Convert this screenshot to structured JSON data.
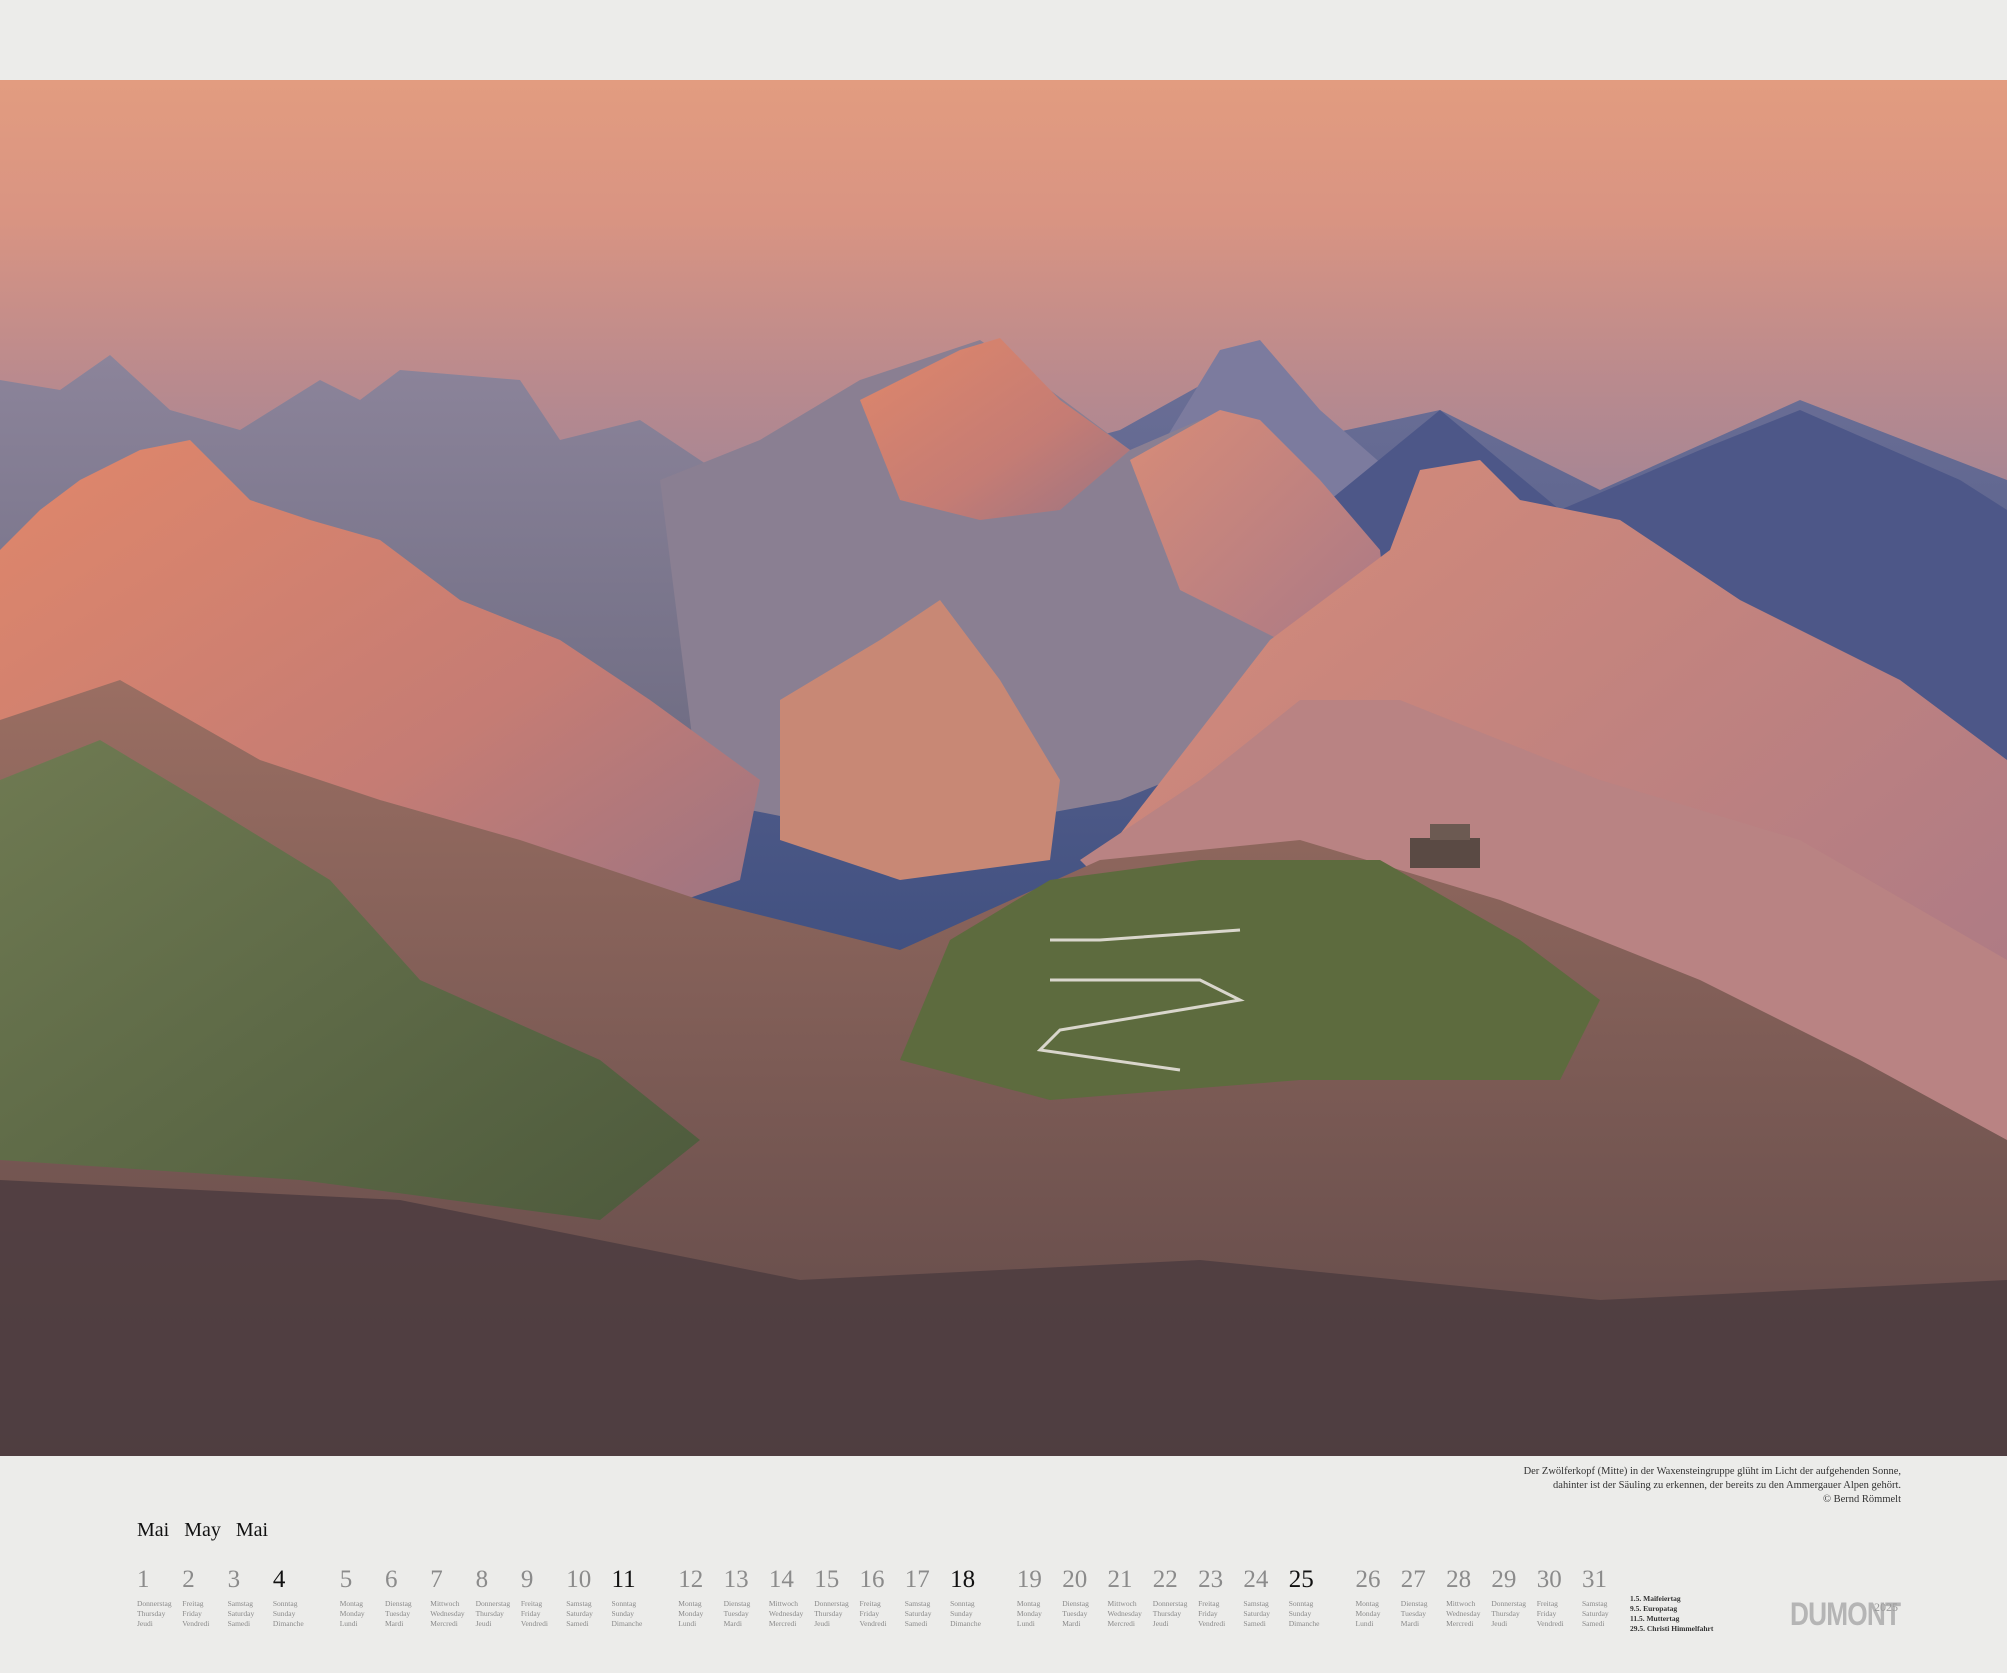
{
  "photo": {
    "name": "Zwölferkopf und Säuling bei Sonnenaufgang"
  },
  "caption": {
    "line1": "Der Zwölferkopf (Mitte) in der Waxensteingruppe glüht im Licht der aufgehenden Sonne,",
    "line2": "dahinter ist der Säuling zu erkennen, der bereits zu den Ammergauer Alpen gehört.",
    "credit": "© Bernd Römmelt"
  },
  "month": {
    "de": "Mai",
    "en": "May",
    "fr": "Mai"
  },
  "days": [
    {
      "n": "1",
      "de": "Donnerstag",
      "en": "Thursday",
      "fr": "Jeudi"
    },
    {
      "n": "2",
      "de": "Freitag",
      "en": "Friday",
      "fr": "Vendredi"
    },
    {
      "n": "3",
      "de": "Samstag",
      "en": "Saturday",
      "fr": "Samedi"
    },
    {
      "n": "4",
      "de": "Sonntag",
      "en": "Sunday",
      "fr": "Dimanche"
    },
    {
      "n": "5",
      "de": "Montag",
      "en": "Monday",
      "fr": "Lundi"
    },
    {
      "n": "6",
      "de": "Dienstag",
      "en": "Tuesday",
      "fr": "Mardi"
    },
    {
      "n": "7",
      "de": "Mittwoch",
      "en": "Wednesday",
      "fr": "Mercredi"
    },
    {
      "n": "8",
      "de": "Donnerstag",
      "en": "Thursday",
      "fr": "Jeudi"
    },
    {
      "n": "9",
      "de": "Freitag",
      "en": "Friday",
      "fr": "Vendredi"
    },
    {
      "n": "10",
      "de": "Samstag",
      "en": "Saturday",
      "fr": "Samedi"
    },
    {
      "n": "11",
      "de": "Sonntag",
      "en": "Sunday",
      "fr": "Dimanche"
    },
    {
      "n": "12",
      "de": "Montag",
      "en": "Monday",
      "fr": "Lundi"
    },
    {
      "n": "13",
      "de": "Dienstag",
      "en": "Tuesday",
      "fr": "Mardi"
    },
    {
      "n": "14",
      "de": "Mittwoch",
      "en": "Wednesday",
      "fr": "Mercredi"
    },
    {
      "n": "15",
      "de": "Donnerstag",
      "en": "Thursday",
      "fr": "Jeudi"
    },
    {
      "n": "16",
      "de": "Freitag",
      "en": "Friday",
      "fr": "Vendredi"
    },
    {
      "n": "17",
      "de": "Samstag",
      "en": "Saturday",
      "fr": "Samedi"
    },
    {
      "n": "18",
      "de": "Sonntag",
      "en": "Sunday",
      "fr": "Dimanche"
    },
    {
      "n": "19",
      "de": "Montag",
      "en": "Monday",
      "fr": "Lundi"
    },
    {
      "n": "20",
      "de": "Dienstag",
      "en": "Tuesday",
      "fr": "Mardi"
    },
    {
      "n": "21",
      "de": "Mittwoch",
      "en": "Wednesday",
      "fr": "Mercredi"
    },
    {
      "n": "22",
      "de": "Donnerstag",
      "en": "Thursday",
      "fr": "Jeudi"
    },
    {
      "n": "23",
      "de": "Freitag",
      "en": "Friday",
      "fr": "Vendredi"
    },
    {
      "n": "24",
      "de": "Samstag",
      "en": "Saturday",
      "fr": "Samedi"
    },
    {
      "n": "25",
      "de": "Sonntag",
      "en": "Sunday",
      "fr": "Dimanche"
    },
    {
      "n": "26",
      "de": "Montag",
      "en": "Monday",
      "fr": "Lundi"
    },
    {
      "n": "27",
      "de": "Dienstag",
      "en": "Tuesday",
      "fr": "Mardi"
    },
    {
      "n": "28",
      "de": "Mittwoch",
      "en": "Wednesday",
      "fr": "Mercredi"
    },
    {
      "n": "29",
      "de": "Donnerstag",
      "en": "Thursday",
      "fr": "Jeudi"
    },
    {
      "n": "30",
      "de": "Freitag",
      "en": "Friday",
      "fr": "Vendredi"
    },
    {
      "n": "31",
      "de": "Samstag",
      "en": "Saturday",
      "fr": "Samedi"
    }
  ],
  "holidays": [
    "1.5. Maifeiertag",
    "9.5. Europatag",
    "11.5. Muttertag",
    "29.5. Christi Himmelfahrt"
  ],
  "brand": "DUMONT",
  "year": "2025"
}
